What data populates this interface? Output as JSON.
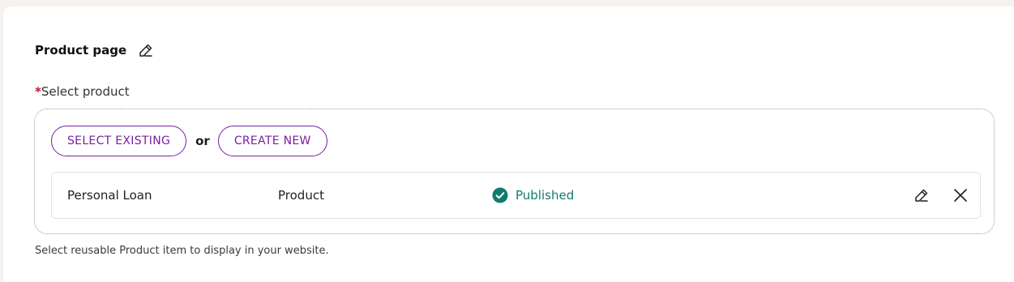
{
  "section": {
    "title": "Product page",
    "title_edit_icon": "pencil-icon"
  },
  "field": {
    "required_marker": "*",
    "label": "Select product",
    "select_existing_label": "SELECT EXISTING",
    "or_label": "or",
    "create_new_label": "CREATE NEW",
    "helper_text": "Select reusable Product item to display in your website."
  },
  "selected_item": {
    "name": "Personal Loan",
    "type": "Product",
    "status": "Published",
    "status_icon": "check-circle-icon",
    "edit_icon": "pencil-icon",
    "remove_icon": "close-icon"
  },
  "colors": {
    "accent": "#7b1fa2",
    "published": "#0f7b6c",
    "required": "#c8102e"
  }
}
